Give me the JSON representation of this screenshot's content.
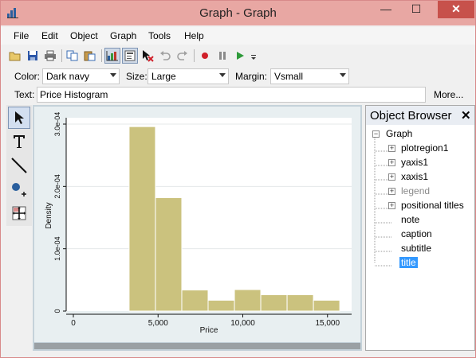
{
  "window": {
    "title": "Graph - Graph",
    "close_glyph": "✕",
    "minimize_glyph": "—",
    "maximize_glyph": "☐"
  },
  "menu": [
    "File",
    "Edit",
    "Object",
    "Graph",
    "Tools",
    "Help"
  ],
  "toolbar": {
    "icons": [
      "open-icon",
      "save-icon",
      "print-icon",
      "copy-icon",
      "paste-icon",
      "graph-editor-icon",
      "object-browser-toggle-icon",
      "pointer-delete-icon",
      "undo-icon",
      "redo-icon",
      "record-icon",
      "pause-icon",
      "play-icon",
      "overflow-icon"
    ]
  },
  "properties": {
    "color_label": "Color:",
    "color_value": "Dark navy",
    "size_label": "Size:",
    "size_value": "Large",
    "margin_label": "Margin:",
    "margin_value": "Vsmall"
  },
  "textbar": {
    "label": "Text:",
    "value": "Price Histogram",
    "more_label": "More..."
  },
  "tools": [
    "pointer-tool-icon",
    "text-tool-icon",
    "line-tool-icon",
    "marker-tool-icon",
    "grid-edit-tool-icon"
  ],
  "colors": {
    "bar_fill": "#cbc27e",
    "bar_stroke": "#ffffff",
    "plot_bg": "#ffffff",
    "graph_bg": "#e8eff1",
    "selection": "#3399ff"
  },
  "chart_data": {
    "type": "bar",
    "xlabel": "Price",
    "ylabel": "Density",
    "xlim": [
      0,
      16000
    ],
    "ylim": [
      0,
      0.0003
    ],
    "xticks": [
      0,
      5000,
      10000,
      15000
    ],
    "xtick_labels": [
      "0",
      "5,000",
      "10,000",
      "15,000"
    ],
    "yticks": [
      0,
      0.0001,
      0.0002,
      0.0003
    ],
    "ytick_labels": [
      "0",
      "1.0e-04",
      "2.0e-04",
      "3.0e-04"
    ],
    "bin_edges": [
      3291,
      4845,
      6399,
      7953,
      9507,
      11061,
      12615,
      14169,
      15723
    ],
    "values": [
      0.000296,
      0.000182,
      3.38e-05,
      1.74e-05,
      3.45e-05,
      2.62e-05,
      2.62e-05,
      1.74e-05
    ],
    "grid": true
  },
  "object_browser": {
    "title": "Object Browser",
    "close_glyph": "✕",
    "items": [
      {
        "label": "Graph",
        "expander": "−",
        "level": 0
      },
      {
        "label": "plotregion1",
        "expander": "+",
        "level": 1
      },
      {
        "label": "yaxis1",
        "expander": "+",
        "level": 1
      },
      {
        "label": "xaxis1",
        "expander": "+",
        "level": 1
      },
      {
        "label": "legend",
        "expander": "+",
        "level": 1,
        "dim": true
      },
      {
        "label": "positional titles",
        "expander": "+",
        "level": 1
      },
      {
        "label": "note",
        "expander": "",
        "level": 1
      },
      {
        "label": "caption",
        "expander": "",
        "level": 1
      },
      {
        "label": "subtitle",
        "expander": "",
        "level": 1
      },
      {
        "label": "title",
        "expander": "",
        "level": 1,
        "selected": true
      }
    ]
  }
}
